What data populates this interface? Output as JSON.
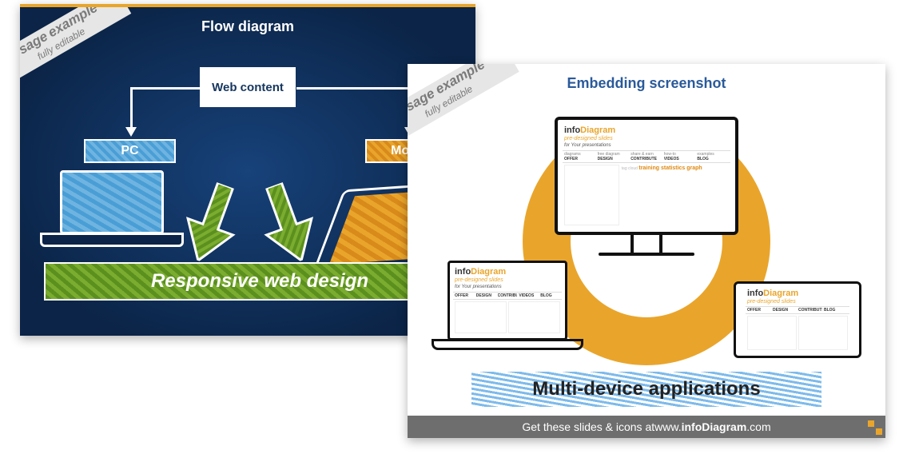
{
  "ribbon": {
    "line1": "Usage",
    "line2": "example",
    "line3": "fully editable"
  },
  "slide1": {
    "title": "Flow diagram",
    "web_content": "Web content",
    "pc_label": "PC",
    "mobile_label": "Mobile",
    "rwd_label": "Responsive web design"
  },
  "slide2": {
    "title": "Embedding screenshot",
    "mda_label": "Multi-device applications",
    "footer_prefix": "Get these slides & icons at ",
    "footer_url_prefix": "www.",
    "footer_brand_a": "info",
    "footer_brand_b": "Diagram",
    "footer_url_suffix": ".com",
    "site": {
      "brand_a": "info",
      "brand_b": "Diagram",
      "tagline": "pre-designed slides",
      "tagline2": "for Your presentations",
      "nav": [
        {
          "top": "diagrams",
          "bottom": "OFFER"
        },
        {
          "top": "free diagram",
          "bottom": "DESIGN"
        },
        {
          "top": "share & earn",
          "bottom": "CONTRIBUTE"
        },
        {
          "top": "how-to",
          "bottom": "VIDEOS"
        },
        {
          "top": "examples",
          "bottom": "BLOG"
        }
      ],
      "tagcloud": "training statistics graph"
    }
  }
}
